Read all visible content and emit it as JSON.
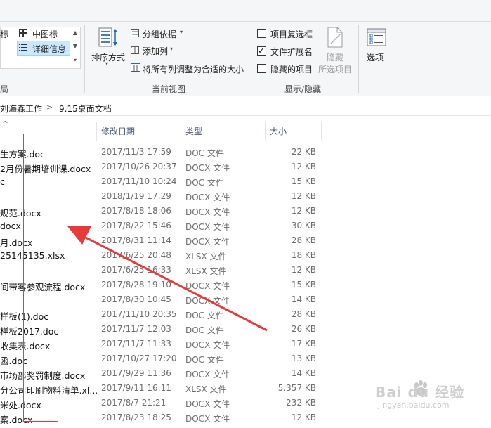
{
  "ribbon": {
    "layout": {
      "item_icons_partial": "标",
      "item_medium": "中图标",
      "item_details": "详细信息"
    },
    "current_view": {
      "sort_label": "排序方式",
      "group_by": "分组依据",
      "add_column": "添加列",
      "fit_columns": "将所有列调整为合适的大小",
      "group_title": "当前视图"
    },
    "show_hide": {
      "item_checkboxes": "项目复选框",
      "file_extensions": "文件扩展名",
      "hidden_items": "隐藏的项目",
      "hide_selected_line1": "隐藏",
      "hide_selected_line2": "所选项目",
      "group_title": "显示/隐藏",
      "checkbox_states": {
        "item_checkboxes": false,
        "file_extensions": true,
        "hidden_items": false
      }
    },
    "options": {
      "label": "选项"
    },
    "left_group_partial": "局"
  },
  "address": {
    "crumb1": "刘海森工作",
    "sep": ">",
    "crumb2": "9.15桌面文档"
  },
  "columns": {
    "date": "修改日期",
    "type": "类型",
    "size": "大小"
  },
  "files": [
    {
      "name": "生方案.doc",
      "date": "2017/11/3 17:59",
      "type": "DOC 文件",
      "size": "22 KB"
    },
    {
      "name": "2月份暑期培训课.docx",
      "date": "2017/10/26 20:37",
      "type": "DOCX 文件",
      "size": "12 KB"
    },
    {
      "name": "c",
      "date": "2017/11/10 10:24",
      "type": "DOC 文件",
      "size": "15 KB"
    },
    {
      "name": "",
      "date": "2018/1/19 17:29",
      "type": "DOCX 文件",
      "size": "12 KB"
    },
    {
      "name": "规范.docx",
      "date": "2017/8/18 18:06",
      "type": "DOCX 文件",
      "size": "12 KB"
    },
    {
      "name": "docx",
      "date": "2017/8/22 15:46",
      "type": "DOCX 文件",
      "size": "30 KB"
    },
    {
      "name": "月.docx",
      "date": "2017/8/31 11:14",
      "type": "DOCX 文件",
      "size": "28 KB"
    },
    {
      "name": "25145135.xlsx",
      "date": "2017/6/25 20:48",
      "type": "XLSX 文件",
      "size": "18 KB"
    },
    {
      "name": "",
      "date": "2017/6/25 16:33",
      "type": "XLSX 文件",
      "size": "12 KB"
    },
    {
      "name": "间带客参观流程.docx",
      "date": "2017/8/28 19:10",
      "type": "DOCX 文件",
      "size": "15 KB"
    },
    {
      "name": "",
      "date": "2017/8/30 10:45",
      "type": "DOCX 文件",
      "size": "14 KB"
    },
    {
      "name": "样板(1).doc",
      "date": "2017/11/10 20:35",
      "type": "DOC 文件",
      "size": "28 KB"
    },
    {
      "name": "样板2017.doc",
      "date": "2017/11/7 12:03",
      "type": "DOC 文件",
      "size": "26 KB"
    },
    {
      "name": "收集表.docx",
      "date": "2017/11/7 11:33",
      "type": "DOCX 文件",
      "size": "17 KB"
    },
    {
      "name": "函.doc",
      "date": "2017/10/27 17:20",
      "type": "DOC 文件",
      "size": "13 KB"
    },
    {
      "name": "市场部奖罚制度.docx",
      "date": "2017/9/29 11:36",
      "type": "DOCX 文件",
      "size": "14 KB"
    },
    {
      "name": "分公司印刷物料清单.xl...",
      "date": "2017/9/11 16:11",
      "type": "XLSX 文件",
      "size": "5,357 KB"
    },
    {
      "name": "米处.docx",
      "date": "2017/8/7 21:21",
      "type": "DOCX 文件",
      "size": "232 KB"
    },
    {
      "name": "案.docx",
      "date": "2017/8/23 18:25",
      "type": "DOCX 文件",
      "size": "12 KB"
    }
  ],
  "watermark": {
    "brand": "Bai du 经验",
    "url": "jingyan.baidu.com"
  },
  "colors": {
    "ribbon_bg": "#f5f6f7",
    "selection": "#cce8ff",
    "annotation_red": "#e83a3a",
    "header_text": "#4d6082",
    "secondary_text": "#6d6d6d"
  },
  "icons": [
    "medium-icons-icon",
    "details-icon",
    "sort-icon",
    "group-by-icon",
    "add-column-icon",
    "fit-columns-icon",
    "hide-selected-icon",
    "options-icon",
    "sort-arrow-icon"
  ]
}
